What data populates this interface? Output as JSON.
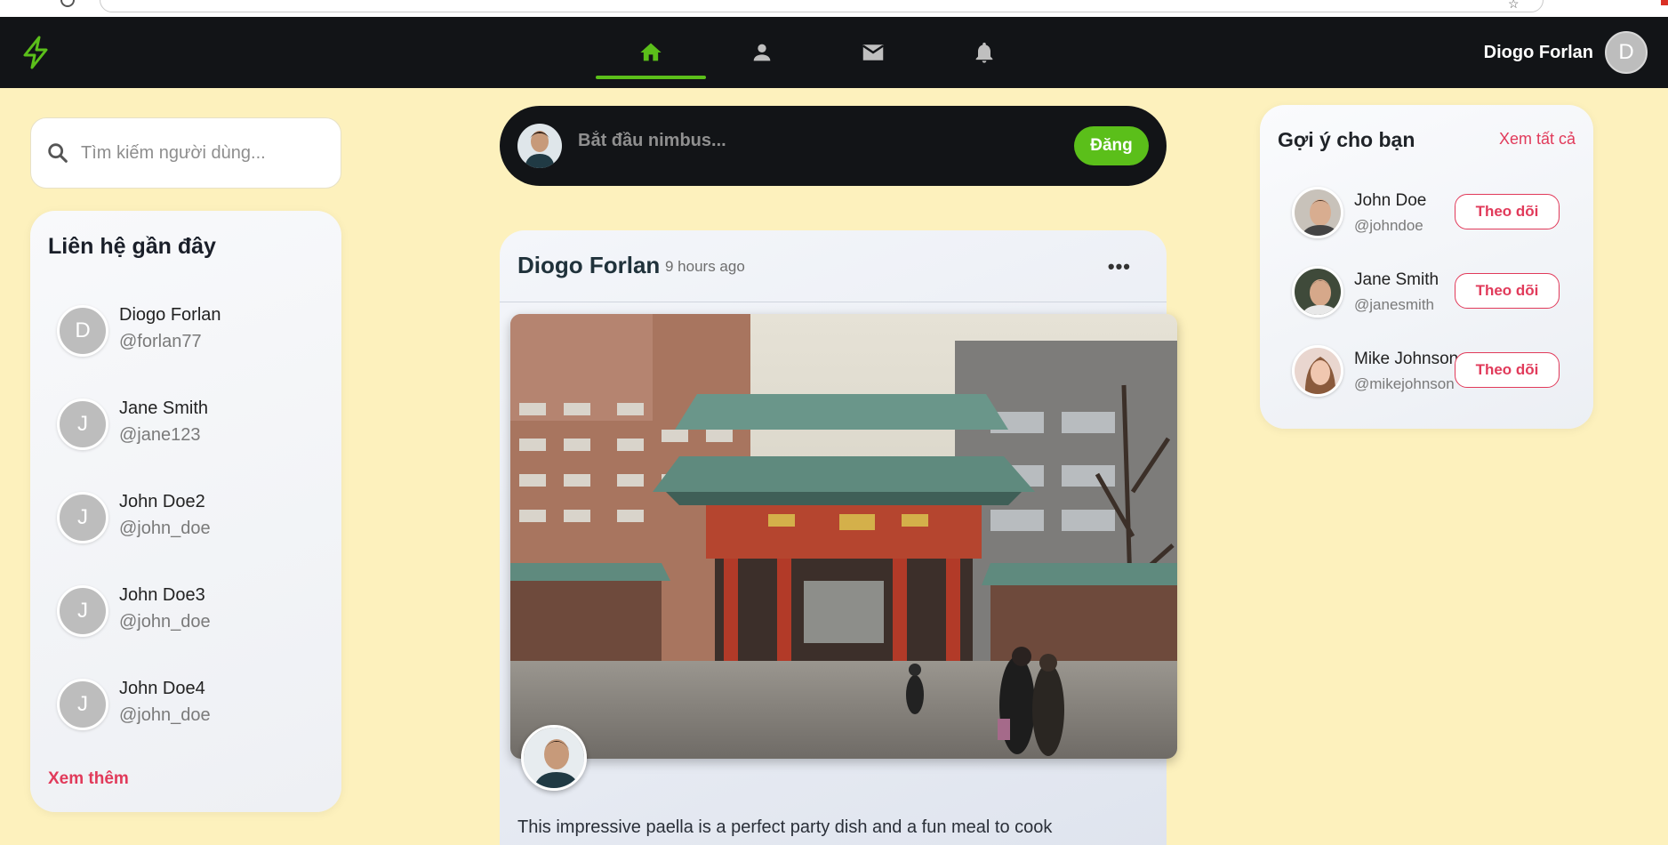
{
  "nav": {
    "user_name": "Diogo Forlan",
    "user_initial": "D",
    "icons": [
      "home-icon",
      "profile-icon",
      "mail-icon",
      "bell-icon"
    ],
    "accent": "#5bbf1a"
  },
  "search": {
    "placeholder": "Tìm kiếm người dùng..."
  },
  "contacts": {
    "title": "Liên hệ gần đây",
    "items": [
      {
        "initial": "D",
        "name": "Diogo Forlan",
        "handle": "@forlan77"
      },
      {
        "initial": "J",
        "name": "Jane Smith",
        "handle": "@jane123"
      },
      {
        "initial": "J",
        "name": "John Doe2",
        "handle": "@john_doe"
      },
      {
        "initial": "J",
        "name": "John Doe3",
        "handle": "@john_doe"
      },
      {
        "initial": "J",
        "name": "John Doe4",
        "handle": "@john_doe"
      }
    ],
    "see_more": "Xem thêm"
  },
  "compose": {
    "placeholder": "Bắt đầu nimbus...",
    "post_label": "Đăng"
  },
  "post": {
    "author": "Diogo Forlan",
    "time": "9 hours ago",
    "menu": "•••",
    "text": "This impressive paella is a perfect party dish and a fun meal to cook"
  },
  "suggestions": {
    "title": "Gợi ý cho bạn",
    "see_all": "Xem tất cả",
    "follow_label": "Theo dõi",
    "items": [
      {
        "name": "John Doe",
        "handle": "@johndoe"
      },
      {
        "name": "Jane Smith",
        "handle": "@janesmith"
      },
      {
        "name": "Mike Johnson",
        "handle": "@mikejohnson"
      }
    ],
    "accent": "#e13a5a"
  }
}
